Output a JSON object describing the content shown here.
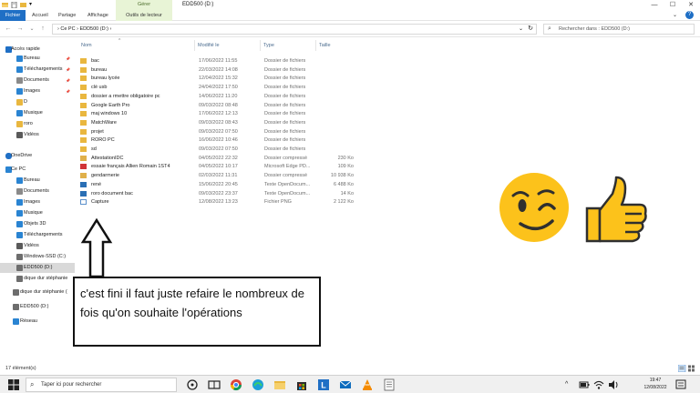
{
  "window": {
    "manage_tab": "Gérer",
    "title": "EDD500 (D:)",
    "controls": {
      "minimize": "—",
      "maximize": "☐",
      "close": "✕"
    }
  },
  "ribbon": {
    "tabs": [
      "Fichier",
      "Accueil",
      "Partage",
      "Affichage",
      "Outils de lecteur"
    ]
  },
  "address": {
    "path": "›  Ce PC  ›  EDD500 (D:)  ›",
    "refresh": "↻",
    "search_placeholder": "Rechercher dans : EDD500 (D:)"
  },
  "sidebar": {
    "items": [
      {
        "label": "Accès rapide",
        "icon": "star-icon",
        "pinned": false
      },
      {
        "label": "Bureau",
        "icon": "desktop-icon",
        "pinned": true
      },
      {
        "label": "Téléchargements",
        "icon": "download-icon",
        "pinned": true
      },
      {
        "label": "Documents",
        "icon": "documents-icon",
        "pinned": true
      },
      {
        "label": "Images",
        "icon": "images-icon",
        "pinned": true
      },
      {
        "label": "D",
        "icon": "folder-icon",
        "pinned": false
      },
      {
        "label": "Musique",
        "icon": "music-icon",
        "pinned": false
      },
      {
        "label": "roro",
        "icon": "folder-icon",
        "pinned": false
      },
      {
        "label": "Vidéos",
        "icon": "videos-icon",
        "pinned": false
      },
      {
        "label": "OneDrive",
        "icon": "cloud-icon",
        "pinned": false
      },
      {
        "label": "Ce PC",
        "icon": "pc-icon",
        "pinned": false
      },
      {
        "label": "Bureau",
        "icon": "desktop-icon",
        "pinned": false
      },
      {
        "label": "Documents",
        "icon": "documents-icon",
        "pinned": false
      },
      {
        "label": "Images",
        "icon": "images-icon",
        "pinned": false
      },
      {
        "label": "Musique",
        "icon": "music-icon",
        "pinned": false
      },
      {
        "label": "Objets 3D",
        "icon": "cube-icon",
        "pinned": false
      },
      {
        "label": "Téléchargements",
        "icon": "download-icon",
        "pinned": false
      },
      {
        "label": "Vidéos",
        "icon": "videos-icon",
        "pinned": false
      },
      {
        "label": "Windows-SSD (C:)",
        "icon": "drive-icon",
        "pinned": false
      },
      {
        "label": "EDD500 (D:)",
        "icon": "drive-icon",
        "pinned": false,
        "selected": true
      },
      {
        "label": "dique dur stéphanie",
        "icon": "drive-icon",
        "pinned": false
      },
      {
        "label": "dique dur stéphanie (",
        "icon": "drive-icon",
        "pinned": false
      },
      {
        "label": "EDD500 (D:)",
        "icon": "drive-icon",
        "pinned": false
      },
      {
        "label": "Réseau",
        "icon": "network-icon",
        "pinned": false
      }
    ]
  },
  "columns": {
    "name": "Nom",
    "date": "Modifié le",
    "type": "Type",
    "size": "Taille"
  },
  "files": [
    {
      "name": "bac",
      "date": "17/06/2022 11:55",
      "type": "Dossier de fichiers",
      "size": "",
      "icon": "folder"
    },
    {
      "name": "bureau",
      "date": "22/03/2022 14:08",
      "type": "Dossier de fichiers",
      "size": "",
      "icon": "folder"
    },
    {
      "name": "bureau lycée",
      "date": "12/04/2022 15:32",
      "type": "Dossier de fichiers",
      "size": "",
      "icon": "folder"
    },
    {
      "name": "clé usb",
      "date": "24/04/2022 17:50",
      "type": "Dossier de fichiers",
      "size": "",
      "icon": "folder"
    },
    {
      "name": "dossier a rmettre obligatoire pc",
      "date": "14/06/2022 11:20",
      "type": "Dossier de fichiers",
      "size": "",
      "icon": "folder"
    },
    {
      "name": "Google Earth Pro",
      "date": "09/03/2022 08:48",
      "type": "Dossier de fichiers",
      "size": "",
      "icon": "folder"
    },
    {
      "name": "maj windows 10",
      "date": "17/06/2022 12:13",
      "type": "Dossier de fichiers",
      "size": "",
      "icon": "folder"
    },
    {
      "name": "MatchWare",
      "date": "09/03/2022 08:43",
      "type": "Dossier de fichiers",
      "size": "",
      "icon": "folder"
    },
    {
      "name": "projet",
      "date": "09/03/2022 07:50",
      "type": "Dossier de fichiers",
      "size": "",
      "icon": "folder"
    },
    {
      "name": "RORO PC",
      "date": "16/06/2022 10:46",
      "type": "Dossier de fichiers",
      "size": "",
      "icon": "folder"
    },
    {
      "name": "sd",
      "date": "09/03/2022 07:50",
      "type": "Dossier de fichiers",
      "size": "",
      "icon": "folder"
    },
    {
      "name": "AttestationIDC",
      "date": "04/05/2022 22:32",
      "type": "Dossier compressé",
      "size": "230 Ko",
      "icon": "zip"
    },
    {
      "name": "essaie français Allien Romain 1ST4",
      "date": "04/05/2022 10:17",
      "type": "Microsoft Edge PD...",
      "size": "109 Ko",
      "icon": "pdf"
    },
    {
      "name": "gendarmerie",
      "date": "02/03/2022 11:31",
      "type": "Dossier compressé",
      "size": "10 938 Ko",
      "icon": "zip"
    },
    {
      "name": "rené",
      "date": "15/06/2022 20:45",
      "type": "Texte OpenDocum...",
      "size": "6 488 Ko",
      "icon": "doc"
    },
    {
      "name": "roro document bac",
      "date": "09/03/2022 23:37",
      "type": "Texte OpenDocum...",
      "size": "14 Ko",
      "icon": "doc"
    },
    {
      "name": "Capture",
      "date": "12/08/2022 13:23",
      "type": "Fichier PNG",
      "size": "2 122 Ko",
      "icon": "png"
    }
  ],
  "status": {
    "count": "17 élément(s)"
  },
  "annotation": {
    "text": "c'est fini il faut juste refaire le nombreux de fois qu'on souhaite l'opérations"
  },
  "taskbar": {
    "search_placeholder": "Taper ici pour rechercher",
    "time": "19:47",
    "date": "12/08/2022"
  },
  "colors": {
    "accent": "#1f6fc5",
    "folder": "#e9b73f",
    "emoji": "#fcc21b",
    "manage": "#e8f4d6"
  }
}
